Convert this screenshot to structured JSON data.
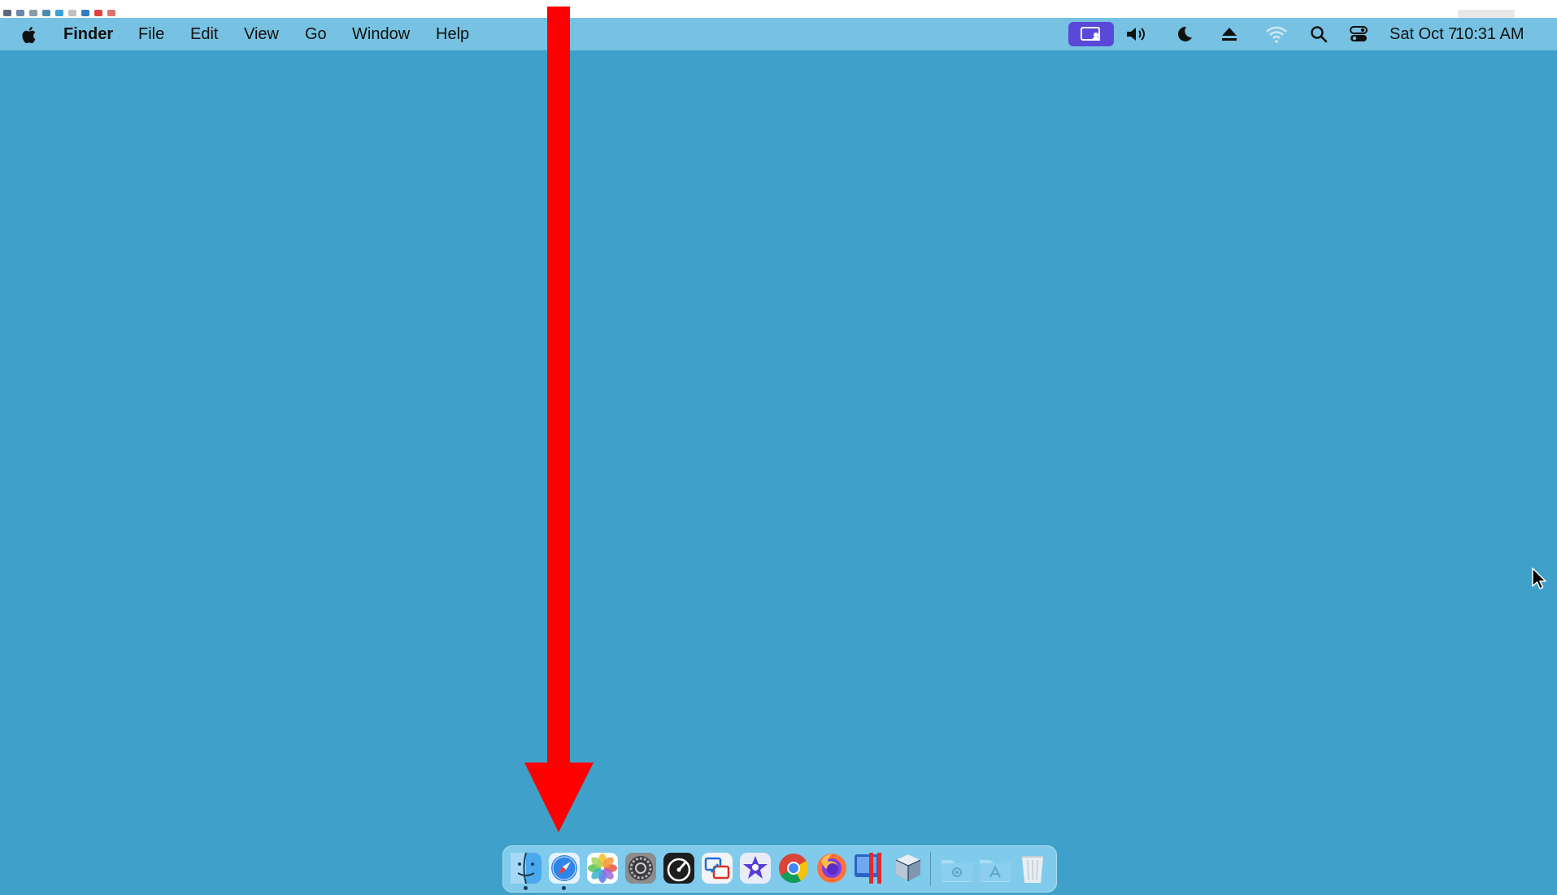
{
  "menubar": {
    "apple_icon": "apple-icon",
    "app_name": "Finder",
    "menus": [
      "File",
      "Edit",
      "View",
      "Go",
      "Window",
      "Help"
    ],
    "status_icons": [
      "screen-share-icon",
      "volume-icon",
      "moon-icon",
      "eject-icon",
      "wifi-icon",
      "search-icon",
      "control-center-icon"
    ],
    "date": "Sat Oct 7",
    "time": "10:31 AM",
    "screen_share_color": "#5a48d8"
  },
  "desktop": {
    "background_color": "#3fa1c9",
    "annotation_arrow_color": "#ff0000"
  },
  "dock": {
    "apps": [
      {
        "icon": "finder-icon",
        "running": true
      },
      {
        "icon": "safari-icon",
        "running": true
      },
      {
        "icon": "photos-icon",
        "running": false
      },
      {
        "icon": "system-settings-icon",
        "running": false
      },
      {
        "icon": "activity-gauge-icon",
        "running": false
      },
      {
        "icon": "screen-sharing-icon",
        "running": false
      },
      {
        "icon": "star-app-icon",
        "running": false
      },
      {
        "icon": "chrome-icon",
        "running": false
      },
      {
        "icon": "firefox-icon",
        "running": false
      },
      {
        "icon": "parallels-icon",
        "running": false
      },
      {
        "icon": "virtualbox-icon",
        "running": false
      }
    ],
    "stack_items": [
      "downloads-folder-icon",
      "applications-folder-icon",
      "trash-icon"
    ]
  }
}
